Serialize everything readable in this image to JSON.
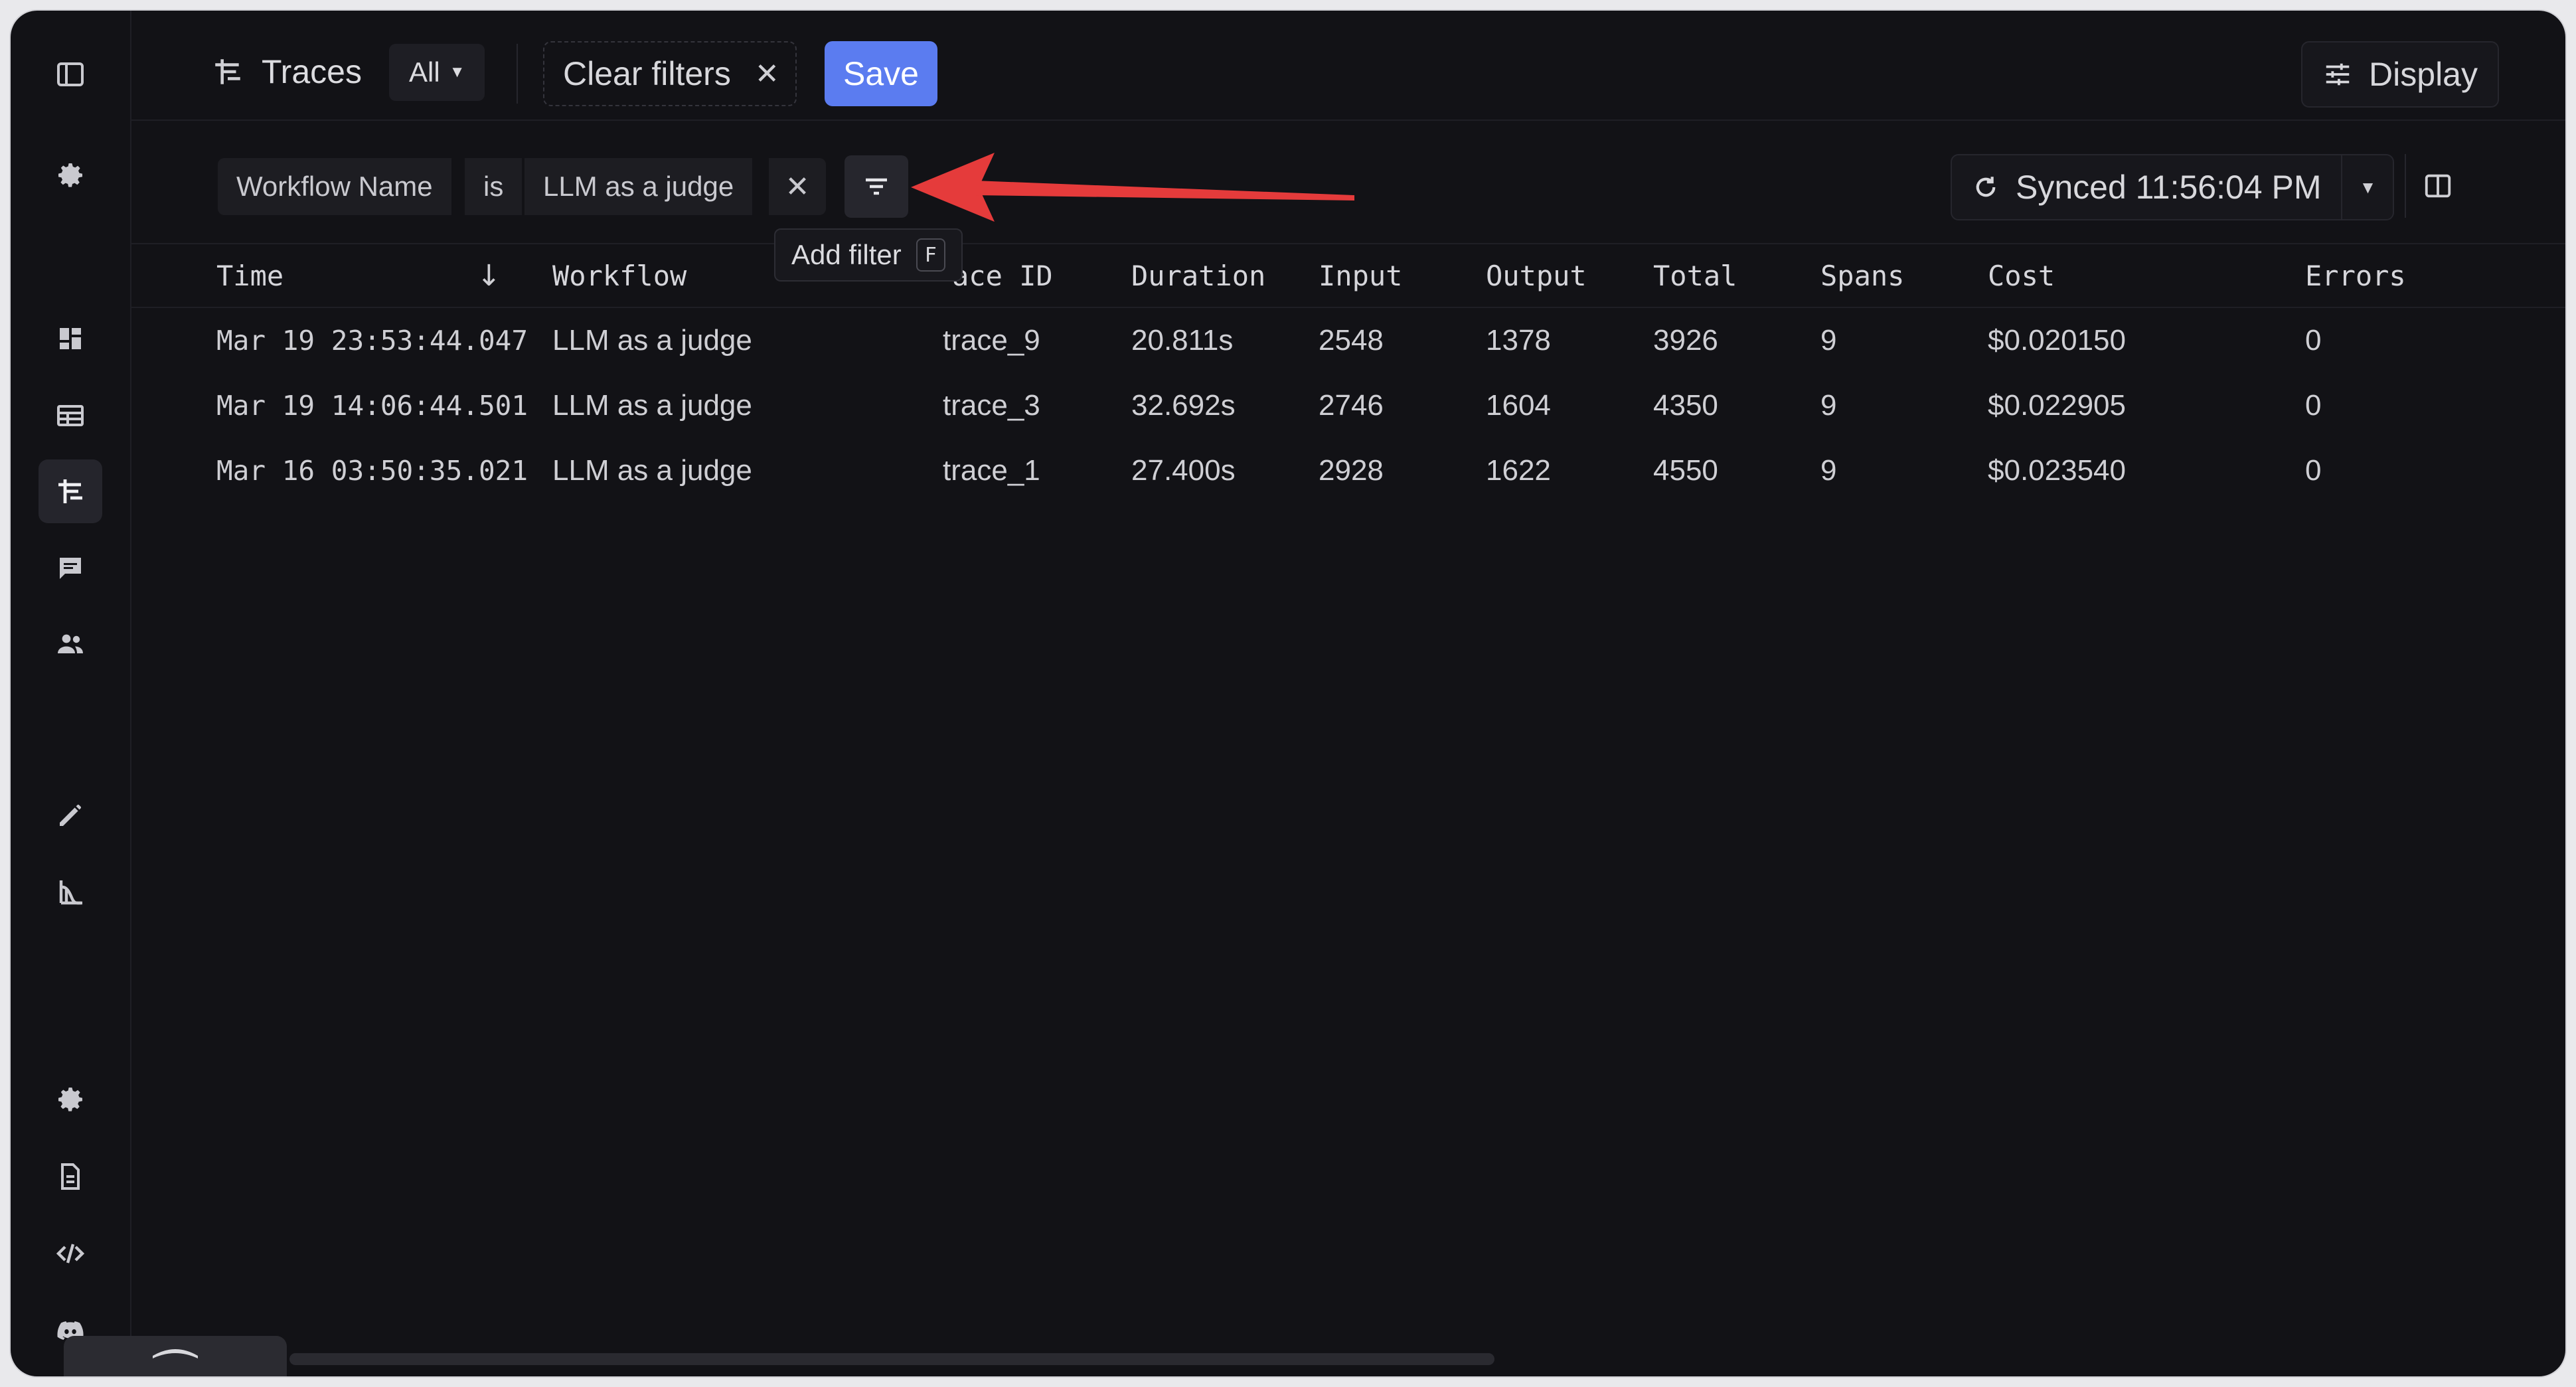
{
  "topbar": {
    "title": "Traces",
    "view_selector": "All",
    "clear_filters": "Clear filters",
    "save": "Save",
    "display": "Display"
  },
  "filters": {
    "field": "Workflow Name",
    "operator": "is",
    "value": "LLM as a judge",
    "tooltip": "Add filter",
    "tooltip_shortcut": "F",
    "sync_status": "Synced 11:56:04 PM"
  },
  "table": {
    "columns": [
      "Time",
      "Workflow",
      "ace ID",
      "Duration",
      "Input",
      "Output",
      "Total",
      "Spans",
      "Cost",
      "Errors"
    ],
    "rows": [
      {
        "time": "Mar 19 23:53:44.047",
        "workflow": "LLM as a judge",
        "trace_id": "trace_9",
        "duration": "20.811s",
        "input": "2548",
        "output": "1378",
        "total": "3926",
        "spans": "9",
        "cost": "$0.020150",
        "errors": "0"
      },
      {
        "time": "Mar 19 14:06:44.501",
        "workflow": "LLM as a judge",
        "trace_id": "trace_3",
        "duration": "32.692s",
        "input": "2746",
        "output": "1604",
        "total": "4350",
        "spans": "9",
        "cost": "$0.022905",
        "errors": "0"
      },
      {
        "time": "Mar 16 03:50:35.021",
        "workflow": "LLM as a judge",
        "trace_id": "trace_1",
        "duration": "27.400s",
        "input": "2928",
        "output": "1622",
        "total": "4550",
        "spans": "9",
        "cost": "$0.023540",
        "errors": "0"
      }
    ]
  },
  "sidebar": {
    "icons": [
      "sidebar-toggle-icon",
      "gear-icon",
      "dashboard-icon",
      "table-icon",
      "traces-icon",
      "chat-icon",
      "users-icon",
      "pencil-icon",
      "chart-icon",
      "settings-icon",
      "document-icon",
      "code-icon",
      "discord-icon"
    ]
  },
  "colors": {
    "background": "#121216",
    "accent": "#5b7cf0",
    "annotation_arrow": "#e53b3b"
  }
}
